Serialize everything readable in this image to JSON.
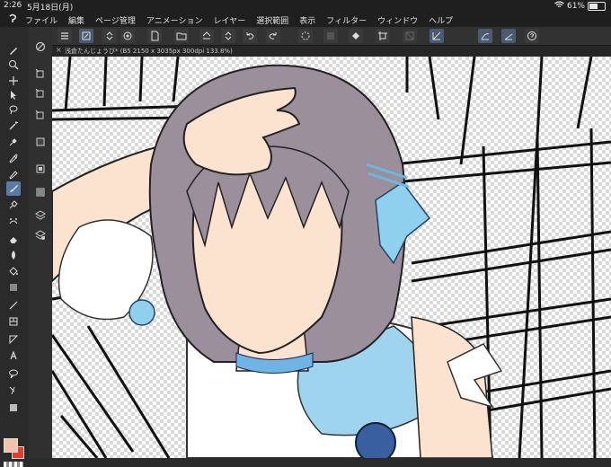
{
  "status": {
    "time": "2:26",
    "date": "5月18日(月)",
    "battery": "61%",
    "battery_level": 0.61
  },
  "app": {
    "logo": "clip-studio-logo"
  },
  "menu": [
    "ファイル",
    "編集",
    "ページ管理",
    "アニメーション",
    "レイヤー",
    "選択範囲",
    "表示",
    "フィルター",
    "ウィンドウ",
    "ヘルプ"
  ],
  "document": {
    "tab_title": "浅倉たんじょうび* (B5 2150 x 3035px 300dpi 133.8%)"
  },
  "colors": {
    "main_color": "#f2c5a8",
    "sub_color": "#e53a2e",
    "accent": "#5a7aa8"
  },
  "toolbar_icons": [
    "menu-icon",
    "new-canvas-icon",
    "stepper-icon",
    "camera-icon",
    "new-file-icon",
    "open-folder-icon",
    "save-icon",
    "stepper-icon",
    "undo-icon",
    "redo-icon",
    "loading-icon",
    "clear-icon",
    "fill-icon",
    "transform-icon",
    "hide-selection-icon",
    "snap-ruler-icon",
    "snap-special-ruler-icon",
    "snap-grid-icon",
    "help-icon"
  ],
  "tools": [
    "pen-icon",
    "zoom-icon",
    "move-icon",
    "operation-icon",
    "lasso-icon",
    "magic-wand-icon",
    "eyedropper-icon",
    "pen-tool-icon",
    "pencil-icon",
    "brush-icon",
    "airbrush-icon",
    "decoration-icon",
    "eraser-icon",
    "color-mix-icon",
    "fill-bucket-icon",
    "gradient-icon",
    "figure-icon",
    "frame-icon",
    "ruler-icon",
    "text-icon",
    "balloon-icon",
    "correction-icon",
    "color-icon"
  ]
}
